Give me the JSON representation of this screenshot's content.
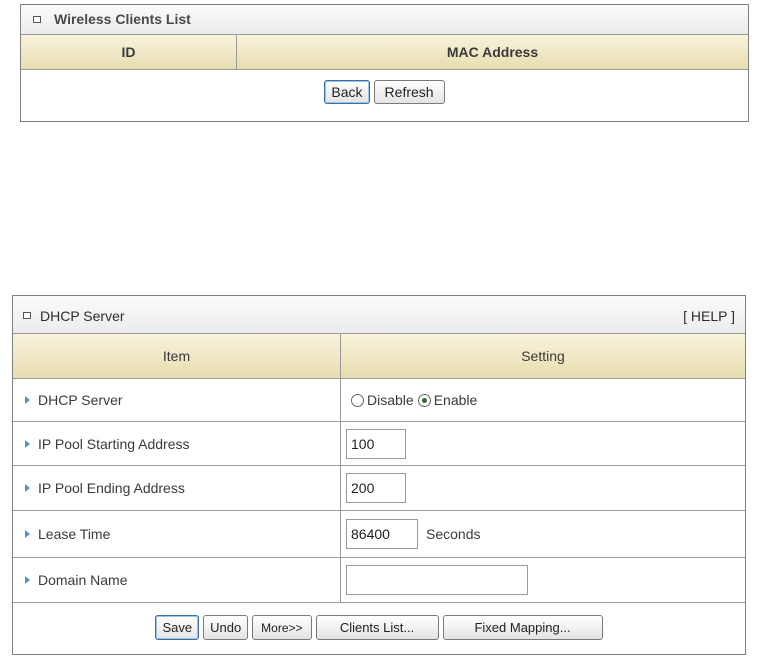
{
  "wireless": {
    "title": "Wireless Clients List",
    "col_id": "ID",
    "col_mac": "MAC Address",
    "back_label": "Back",
    "refresh_label": "Refresh"
  },
  "dhcp": {
    "title": "DHCP Server",
    "help": "[ HELP ]",
    "col_item": "Item",
    "col_setting": "Setting",
    "rows": [
      {
        "label": "DHCP Server"
      },
      {
        "label": "IP Pool Starting Address",
        "value": "100"
      },
      {
        "label": "IP Pool Ending Address",
        "value": "200"
      },
      {
        "label": "Lease Time",
        "value": "86400",
        "unit": "Seconds"
      },
      {
        "label": "Domain Name",
        "value": ""
      }
    ],
    "radio_disable": "Disable",
    "radio_enable": "Enable",
    "selected": "Enable",
    "buttons": {
      "save": "Save",
      "undo": "Undo",
      "more": "More>>",
      "clients_list": "Clients List...",
      "fixed_mapping": "Fixed Mapping..."
    }
  }
}
